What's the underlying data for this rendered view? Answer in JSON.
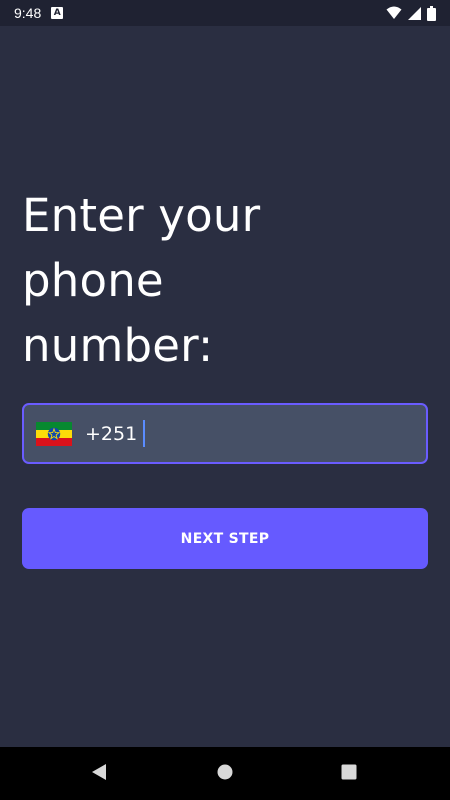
{
  "status_bar": {
    "time": "9:48",
    "app_icon_letter": "A",
    "icons": [
      "wifi-icon",
      "signal-icon",
      "battery-icon"
    ]
  },
  "screen": {
    "title_lines": [
      "Enter your",
      "phone",
      "number:"
    ],
    "phone_input": {
      "country_flag": "ethiopia-flag-icon",
      "dial_code": "+251",
      "value": ""
    },
    "next_button_label": "NEXT STEP"
  },
  "nav_bar": {
    "buttons": [
      "back-icon",
      "home-icon",
      "recents-icon"
    ]
  },
  "colors": {
    "background": "#2a2e41",
    "status_bar": "#1f2232",
    "input_background": "#465066",
    "accent": "#665aff",
    "caret": "#5a8cff"
  }
}
